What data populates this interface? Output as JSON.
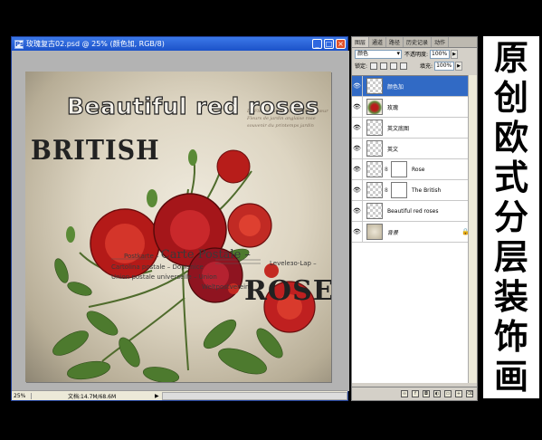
{
  "document": {
    "title": "玫瑰复古02.psd @ 25% (颜色加, RGB/8)",
    "icon_label": "Ps",
    "min_glyph": "_",
    "max_glyph": "□",
    "close_glyph": "×",
    "zoom": "25%",
    "doc_size": "文档:14.7M/68.6M",
    "scroll_arrow": "▶"
  },
  "artwork": {
    "title": "Beautiful red roses",
    "british": "BRITISH",
    "rose": "ROSE",
    "postcard": {
      "line1": "Postkarte –",
      "big": "Carte Postale –",
      "line2": "Cartolina postale – Dopisnice",
      "line3": "Union postale universelle – Union",
      "line4": "Leveleзо-Lap –",
      "line5": "Weltpostverein"
    },
    "script_text": "La Fleur rouge  Lamoure mon cœur  Fleurs de jardin  anglaise  rose  souvenir  du printemps  jardin"
  },
  "layers_panel": {
    "tabs": [
      "图层",
      "通道",
      "路径",
      "历史记录",
      "动作"
    ],
    "blend_mode": "颜色",
    "opacity_label": "不透明度:",
    "opacity_value": "100%",
    "lock_label": "锁定:",
    "fill_label": "填充:",
    "fill_value": "100%",
    "layers": [
      {
        "name": "颜色加",
        "selected": true,
        "thumb": "transparent"
      },
      {
        "name": "玫瑰",
        "selected": false,
        "thumb": "rose"
      },
      {
        "name": "英文底图",
        "selected": false,
        "thumb": "transparent"
      },
      {
        "name": "英文",
        "selected": false,
        "thumb": "transparent"
      },
      {
        "name": "Rose",
        "selected": false,
        "thumb": "transparent",
        "mask": true
      },
      {
        "name": "The British",
        "selected": false,
        "thumb": "transparent",
        "mask": true
      },
      {
        "name": "Beautiful red roses",
        "selected": false,
        "thumb": "transparent"
      },
      {
        "name": "背景",
        "selected": false,
        "thumb": "background",
        "locked": true
      }
    ],
    "footer_icons": [
      "link-icon",
      "fx-icon",
      "mask-icon",
      "adjustment-icon",
      "group-icon",
      "new-layer-icon",
      "trash-icon"
    ]
  },
  "caption": {
    "chars": [
      "原",
      "创",
      "欧",
      "式",
      "分",
      "层",
      "装",
      "饰",
      "画"
    ]
  },
  "colors": {
    "titlebar": "#1c52c9",
    "selected_layer": "#316ac5",
    "rose_red": "#b81d1d"
  }
}
